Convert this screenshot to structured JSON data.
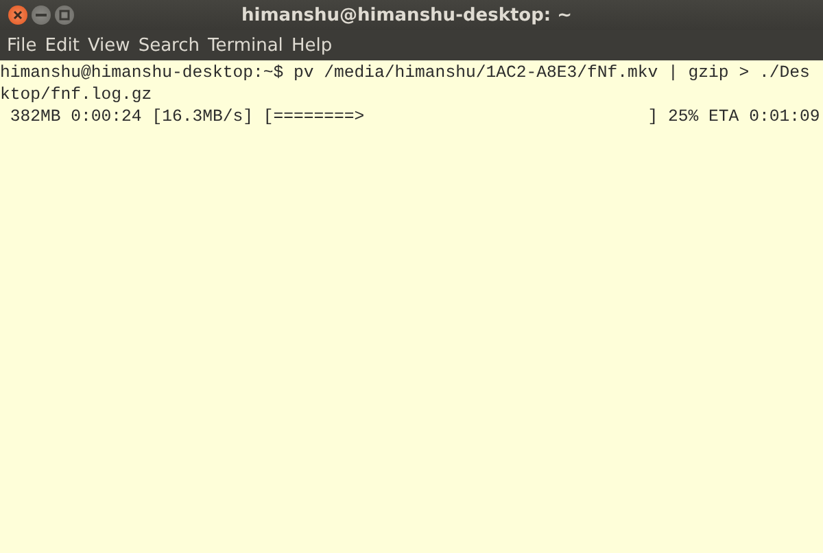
{
  "window": {
    "title": "himanshu@himanshu-desktop: ~"
  },
  "window_buttons": [
    {
      "kind": "close"
    },
    {
      "kind": "minimize"
    },
    {
      "kind": "maximize"
    }
  ],
  "menu": [
    "File",
    "Edit",
    "View",
    "Search",
    "Terminal",
    "Help"
  ],
  "terminal": {
    "lines": [
      "himanshu@himanshu-desktop:~$ pv /media/himanshu/1AC2-A8E3/fNf.mkv | gzip > ./Des",
      "ktop/fnf.log.gz",
      " 382MB 0:00:24 [16.3MB/s] [========>                            ] 25% ETA 0:01:09"
    ]
  }
}
